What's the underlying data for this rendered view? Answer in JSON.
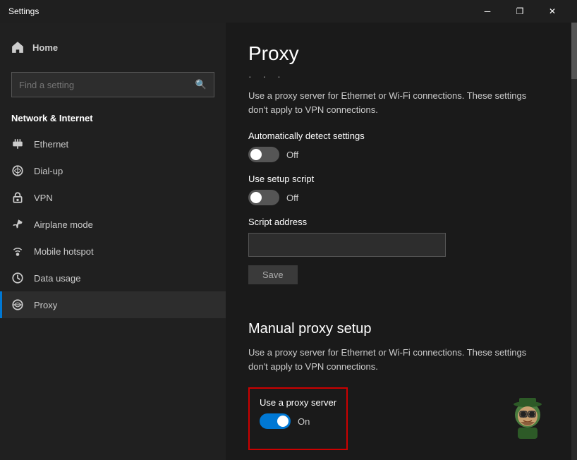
{
  "titleBar": {
    "title": "Settings",
    "minimizeLabel": "─",
    "restoreLabel": "❐",
    "closeLabel": "✕"
  },
  "sidebar": {
    "homeLabel": "Home",
    "searchPlaceholder": "Find a setting",
    "sectionLabel": "Network & Internet",
    "navItems": [
      {
        "id": "ethernet",
        "label": "Ethernet",
        "icon": "ethernet"
      },
      {
        "id": "dialup",
        "label": "Dial-up",
        "icon": "dialup"
      },
      {
        "id": "vpn",
        "label": "VPN",
        "icon": "vpn"
      },
      {
        "id": "airplane",
        "label": "Airplane mode",
        "icon": "airplane"
      },
      {
        "id": "hotspot",
        "label": "Mobile hotspot",
        "icon": "hotspot"
      },
      {
        "id": "datausage",
        "label": "Data usage",
        "icon": "datausage"
      },
      {
        "id": "proxy",
        "label": "Proxy",
        "icon": "proxy",
        "active": true
      }
    ]
  },
  "main": {
    "pageTitle": "Proxy",
    "sectionDots": "· · ·",
    "automaticSetupDescription": "Use a proxy server for Ethernet or Wi-Fi connections. These settings don't apply to VPN connections.",
    "autoDetectLabel": "Automatically detect settings",
    "autoDetectState": "Off",
    "setupScriptLabel": "Use setup script",
    "setupScriptState": "Off",
    "scriptAddressLabel": "Script address",
    "scriptAddressPlaceholder": "",
    "saveButtonLabel": "Save",
    "manualHeading": "Manual proxy setup",
    "manualDescription": "Use a proxy server for Ethernet or Wi-Fi connections. These settings don't apply to VPN connections.",
    "useProxyLabel": "Use a proxy server",
    "useProxyState": "On"
  }
}
